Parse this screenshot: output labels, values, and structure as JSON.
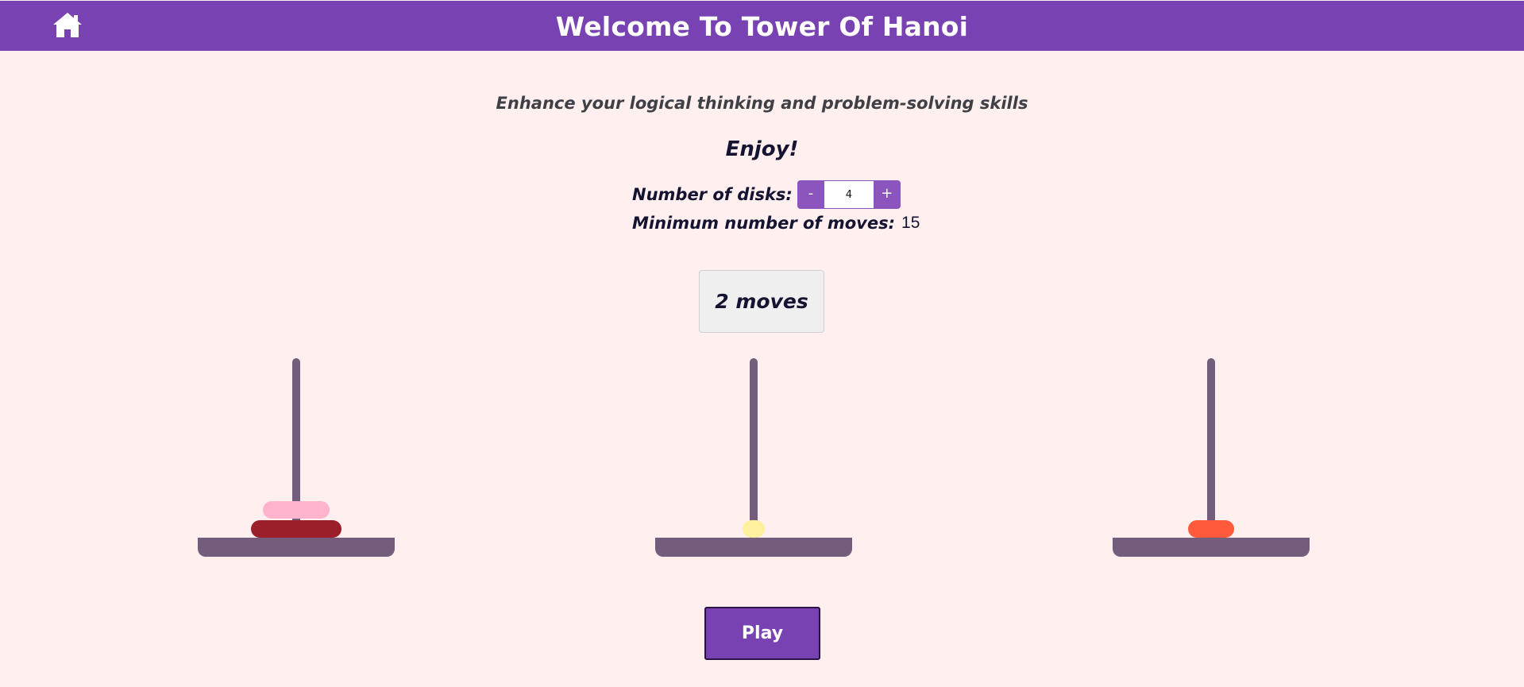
{
  "header": {
    "title": "Welcome To Tower Of Hanoi",
    "home_icon": "home-icon",
    "background": "#7842b2"
  },
  "intro": {
    "subtitle": "Enhance your logical thinking and problem-solving skills",
    "enjoy": "Enjoy!"
  },
  "settings": {
    "disks_label": "Number of disks:",
    "minus_label": "-",
    "plus_label": "+",
    "disks_value": "4",
    "min_moves_label": "Minimum number of moves:",
    "min_moves_value": "15"
  },
  "game": {
    "moves_text": "2 moves",
    "rod_color": "#745c7c",
    "towers": [
      {
        "name": "tower-1",
        "disks": [
          {
            "size": 4,
            "color": "#9b1f2a"
          },
          {
            "size": 3,
            "color": "#ffb3cc"
          }
        ]
      },
      {
        "name": "tower-2",
        "disks": [
          {
            "size": 1,
            "color": "#fff0a0"
          }
        ]
      },
      {
        "name": "tower-3",
        "disks": [
          {
            "size": 2,
            "color": "#ff5a3c"
          }
        ]
      }
    ]
  },
  "actions": {
    "play_label": "Play"
  }
}
